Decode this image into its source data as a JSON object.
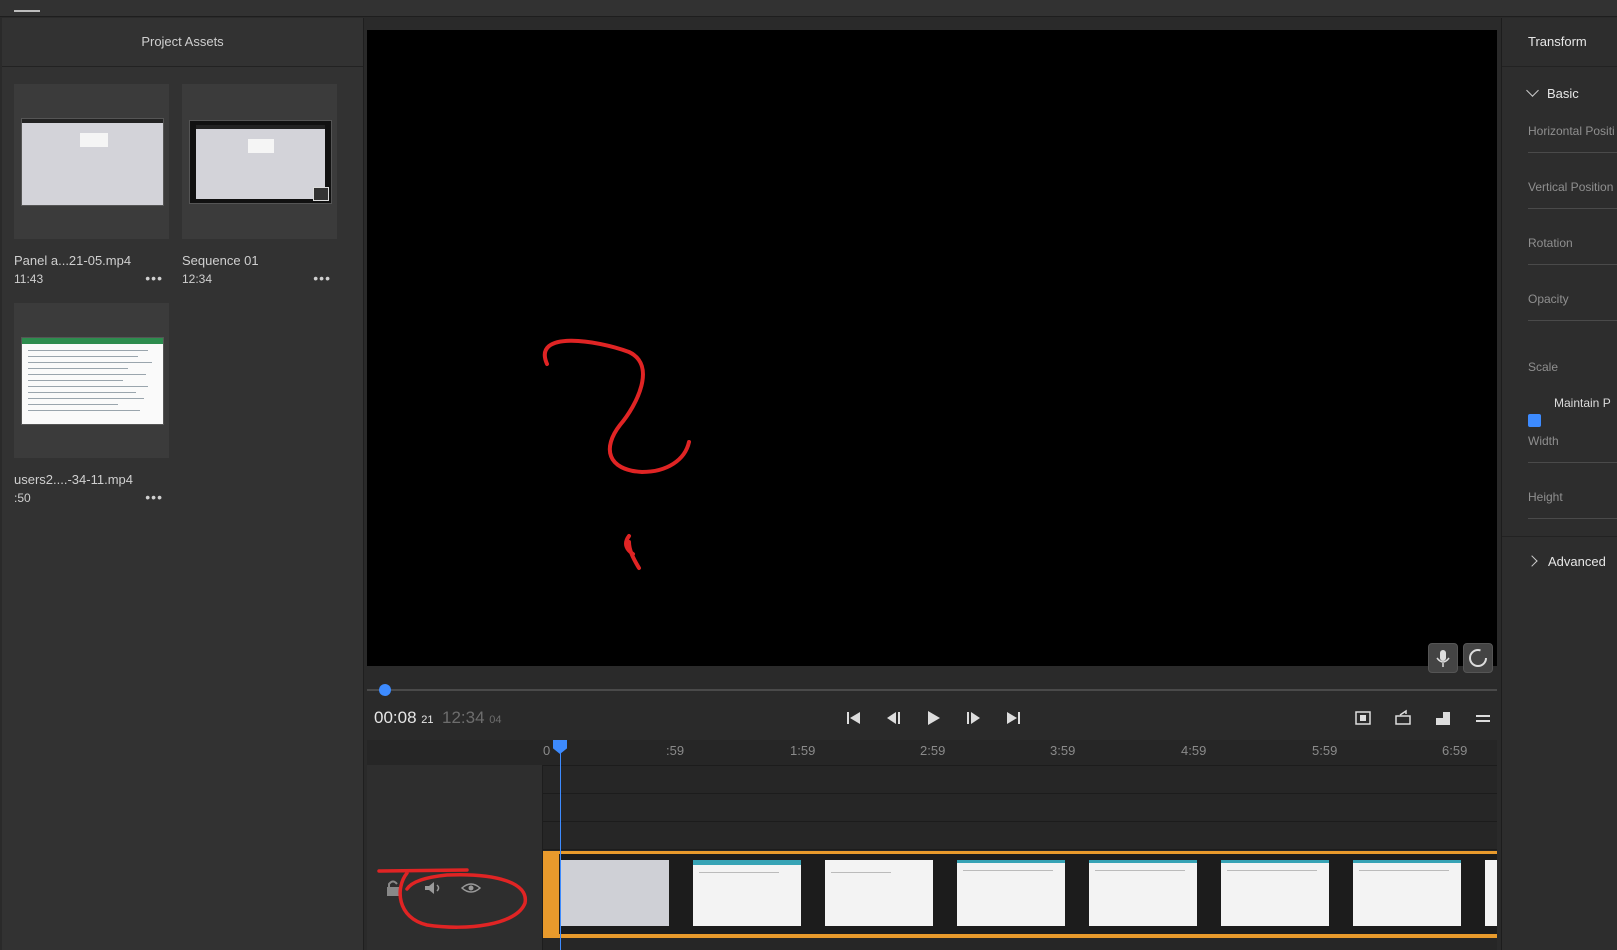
{
  "app": {
    "menu_icon": "hamburger-icon",
    "accent_color": "#3d8bff",
    "clip_color": "#e89a2c",
    "annotation_color": "#e02424"
  },
  "assets_panel": {
    "title": "Project Assets",
    "items": [
      {
        "name": "Panel a...21-05.mp4",
        "duration": "11:43",
        "more": "•••"
      },
      {
        "name": "Sequence 01",
        "duration": "12:34",
        "more": "•••"
      },
      {
        "name": "users2....-34-11.mp4",
        "duration": ":50",
        "more": "•••"
      }
    ]
  },
  "player": {
    "current_time": "00:08",
    "current_frames": "21",
    "total_time": "12:34",
    "total_frames": "04",
    "progress_fraction": 0.011
  },
  "timeline": {
    "ruler_labels": [
      ":59",
      "1:59",
      "2:59",
      "3:59",
      "4:59",
      "5:59",
      "6:59"
    ]
  },
  "properties_panel": {
    "title": "Transform",
    "basic_section": "Basic",
    "fields": {
      "horizontal_position": "Horizontal Positi",
      "vertical_position": "Vertical Position",
      "rotation": "Rotation",
      "opacity": "Opacity",
      "scale": "Scale",
      "maintain": "Maintain P",
      "width": "Width",
      "height": "Height"
    },
    "advanced_section": "Advanced"
  }
}
